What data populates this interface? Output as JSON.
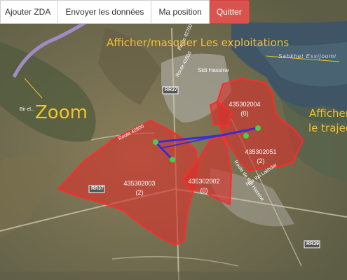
{
  "toolbar": {
    "add_zda": "Ajouter ZDA",
    "send_data": "Envoyer les données",
    "my_position": "Ma position",
    "quit": "Quitter"
  },
  "annotations": {
    "zoom": "Zoom",
    "toggle_exploitations": "Afficher/masquer Les exploitations",
    "show_route_line1": "Afficher",
    "show_route_line2": "le trajec"
  },
  "map_labels": {
    "sebkha": "Sabkhet Essijoumi",
    "sidi_hassine": "Sidi Hassine",
    "rr37_a": "RR37",
    "rr37_b": "RR37",
    "rr39": "RR39",
    "route_42800": "Route 42800",
    "route_42700": "Route 42700",
    "route_1": "Route 42800",
    "route_sidi": "Route de Sidi Hassine",
    "rue_lakhdar": "Rue Ibn Lakhdar",
    "bir_el_kassaa": "Bir el..."
  },
  "parcels": [
    {
      "id": "435302004",
      "count": "(0)"
    },
    {
      "id": "435302051",
      "count": "(2)"
    },
    {
      "id": "435302003",
      "count": "(2)"
    },
    {
      "id": "435302002",
      "count": "(0)"
    }
  ],
  "colors": {
    "parcel_stroke": "#ff2a2a",
    "parcel_fill": "#d8302b",
    "route": "#3b2bd4",
    "waypoint": "#45d04a",
    "annotation": "#f2c230",
    "quit_button": "#d9534f"
  }
}
